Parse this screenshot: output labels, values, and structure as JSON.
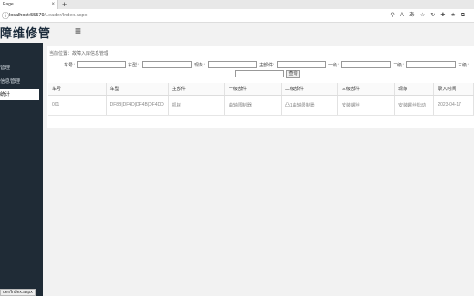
{
  "browser": {
    "tab_title": "Page",
    "tab_close": "×",
    "new_tab": "+",
    "url_host": "localhost:55579",
    "url_path": "/Leader/Index.aspx",
    "status_url": "der/Index.aspx"
  },
  "app": {
    "title": "障维修管",
    "menu_icon": "≡"
  },
  "sidebar": {
    "items": [
      {
        "label": "管理"
      },
      {
        "label": "信息管理"
      },
      {
        "label": "统计"
      }
    ]
  },
  "breadcrumb": "当前位置：故障入库信息管理",
  "filters": {
    "car_no": "车号：",
    "car_type": "车型：",
    "phenomenon": "现象：",
    "main_part": "主部件：",
    "level1": "一级：",
    "level2": "二级：",
    "level3": "三级：",
    "search": "查询"
  },
  "table": {
    "headers": [
      "车号",
      "车型",
      "主部件",
      "一级部件",
      "二级部件",
      "三级部件",
      "现象",
      "录入时间"
    ],
    "rows": [
      [
        "001",
        "DF8B|DF4D|DF4B|DF4DD",
        "机械",
        "曲轴限制器",
        "凸1曲轴限制器",
        "安装螺丝",
        "安装螺丝松动",
        "2023-04-17"
      ]
    ]
  }
}
